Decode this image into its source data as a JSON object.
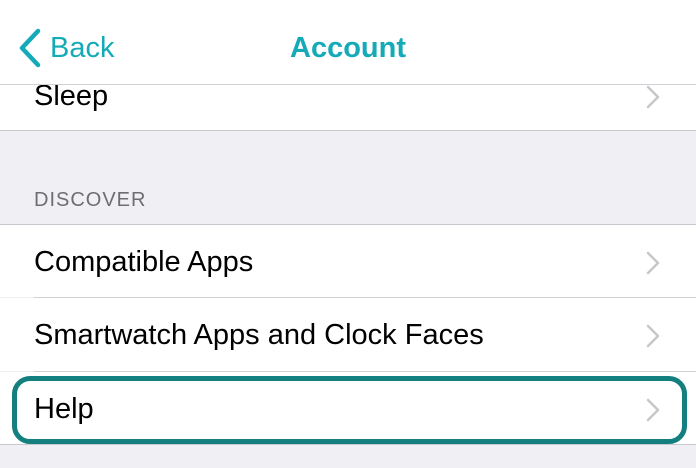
{
  "navbar": {
    "back_label": "Back",
    "title": "Account",
    "accent_color": "#14aab7"
  },
  "rows": {
    "sleep": {
      "label": "Sleep"
    }
  },
  "discover": {
    "header": "DISCOVER",
    "items": [
      {
        "label": "Compatible Apps"
      },
      {
        "label": "Smartwatch Apps and Clock Faces"
      },
      {
        "label": "Help",
        "highlighted": true
      }
    ]
  },
  "icons": {
    "back": "chevron-left-icon",
    "disclosure": "chevron-right-icon"
  },
  "colors": {
    "background": "#efeff4",
    "highlight_ring": "#147f7f"
  }
}
